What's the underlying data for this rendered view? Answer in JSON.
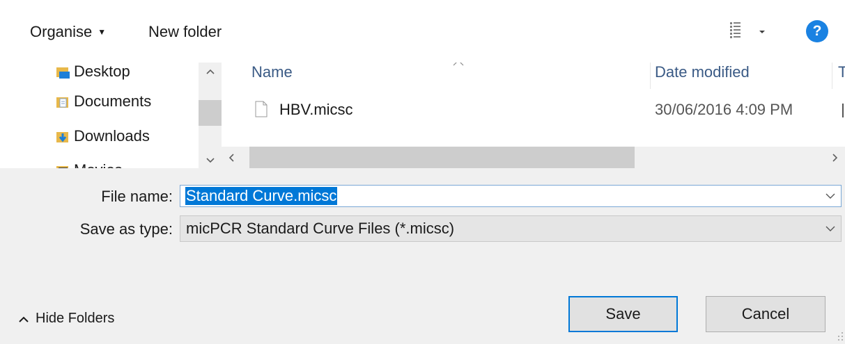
{
  "toolbar": {
    "organise_label": "Organise",
    "new_folder_label": "New folder",
    "help_label": "?"
  },
  "nav": {
    "items": [
      {
        "label": "Desktop",
        "icon": "desktop-folder-icon"
      },
      {
        "label": "Documents",
        "icon": "documents-folder-icon"
      },
      {
        "label": "Downloads",
        "icon": "downloads-folder-icon"
      },
      {
        "label": "Movies",
        "icon": "movies-folder-icon"
      }
    ]
  },
  "file_list": {
    "columns": [
      "Name",
      "Date modified"
    ],
    "rows": [
      {
        "name": "HBV.micsc",
        "date_modified": "30/06/2016 4:09 PM"
      }
    ]
  },
  "form": {
    "file_name_label": "File name:",
    "file_name_value": "Standard Curve.micsc",
    "save_type_label": "Save as type:",
    "save_type_value": "micPCR Standard Curve Files (*.micsc)"
  },
  "footer": {
    "hide_folders_label": "Hide Folders",
    "save_label": "Save",
    "cancel_label": "Cancel"
  },
  "colors": {
    "accent": "#0078d7",
    "help_button": "#1a82e2",
    "column_header_text": "#3a5a85"
  }
}
